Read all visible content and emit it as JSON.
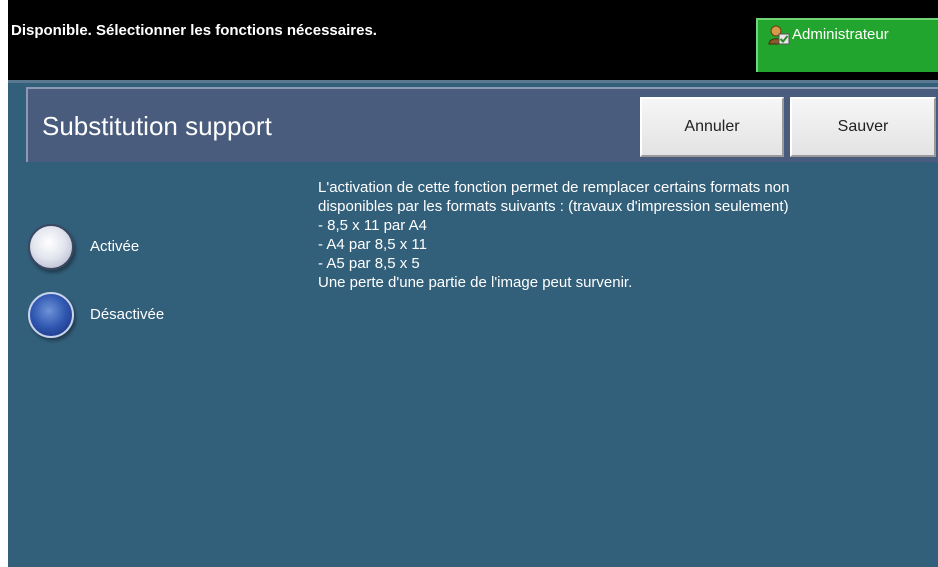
{
  "status_bar": {
    "message": "Disponible.  Sélectionner les fonctions nécessaires.",
    "admin_label": "Administrateur"
  },
  "header": {
    "title": "Substitution support",
    "cancel_label": "Annuler",
    "save_label": "Sauver"
  },
  "options": [
    {
      "label": "Activée",
      "selected": false
    },
    {
      "label": "Désactivée",
      "selected": true
    }
  ],
  "description": {
    "lines": [
      "L'activation de cette fonction permet de remplacer certains formats non",
      "disponibles par les formats suivants : (travaux d'impression seulement)",
      "- 8,5 x 11 par A4",
      "- A4 par 8,5 x 11",
      "- A5 par 8,5 x 5",
      "Une perte d'une partie de l'image peut survenir."
    ]
  },
  "colors": {
    "background": "#325f7a",
    "admin_button": "#22a52e",
    "header_panel": "#4a5c7d"
  }
}
